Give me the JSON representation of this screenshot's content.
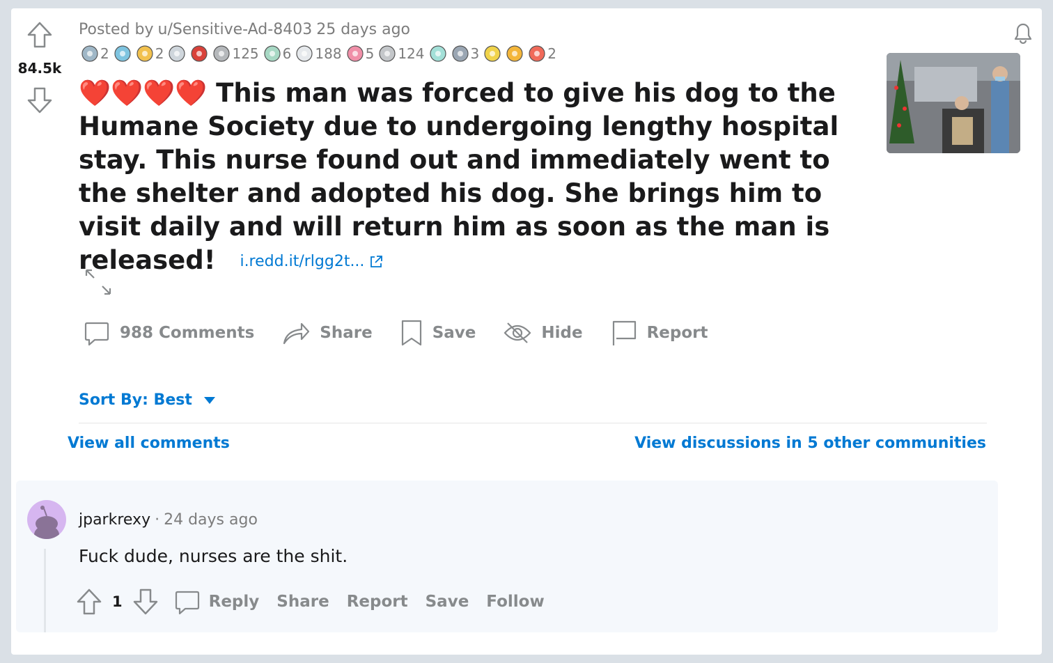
{
  "post": {
    "score": "84.5k",
    "meta_prefix": "Posted by",
    "author": "u/Sensitive-Ad-8403",
    "time": "25 days ago",
    "hearts": "❤️❤️❤️❤️",
    "title": "This man was forced to give his dog to the Humane Society due to undergoing lengthy hospital stay. This nurse found out and immediately went to the shelter and adopted his dog. She brings him to visit daily and will return him as soon as the man is released!",
    "link": "i.redd.it/rlgg2t...",
    "awards": [
      {
        "icon": "silver-award-icon",
        "count": "2"
      },
      {
        "icon": "wholesome-seal-icon",
        "count": ""
      },
      {
        "icon": "star-award-icon",
        "count": "2"
      },
      {
        "icon": "snoo-award-icon",
        "count": ""
      },
      {
        "icon": "heart-gem-icon",
        "count": ""
      },
      {
        "icon": "hug-award-icon",
        "count": "125"
      },
      {
        "icon": "angel-award-icon",
        "count": "6"
      },
      {
        "icon": "wholesome-award-icon",
        "count": "188"
      },
      {
        "icon": "heart-eyes-award-icon",
        "count": "5"
      },
      {
        "icon": "silver-coin-icon",
        "count": "124"
      },
      {
        "icon": "take-my-energy-icon",
        "count": ""
      },
      {
        "icon": "tip-hat-icon",
        "count": "3"
      },
      {
        "icon": "helpful-award-icon",
        "count": ""
      },
      {
        "icon": "sun-award-icon",
        "count": ""
      },
      {
        "icon": "love-snoo-award-icon",
        "count": "2"
      }
    ],
    "actions": {
      "comments": "988 Comments",
      "share": "Share",
      "save": "Save",
      "hide": "Hide",
      "report": "Report"
    }
  },
  "sort": {
    "label": "Sort By: Best"
  },
  "view_all": "View all comments",
  "view_other": "View discussions in 5 other communities",
  "comment": {
    "author": "jparkrexy",
    "dot": "·",
    "time": "24 days ago",
    "body": "Fuck dude, nurses are the shit.",
    "score": "1",
    "reply": "Reply",
    "share": "Share",
    "report": "Report",
    "save": "Save",
    "follow": "Follow"
  },
  "colors": {
    "link": "#0079d3",
    "muted": "#878a8c",
    "background": "#dae0e6"
  }
}
